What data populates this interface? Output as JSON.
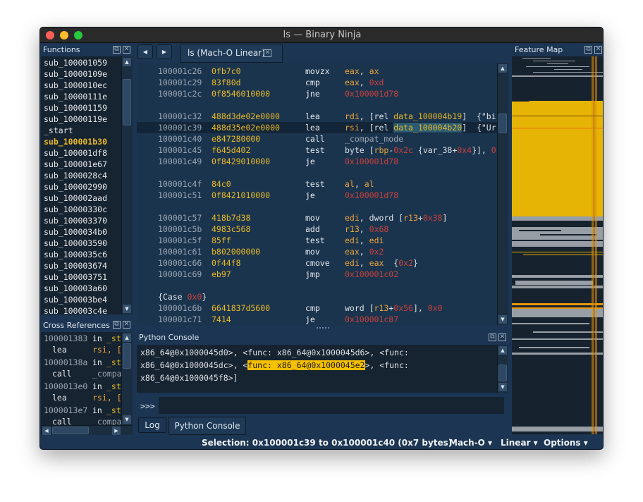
{
  "window": {
    "title": "ls — Binary Ninja"
  },
  "functions": {
    "title": "Functions",
    "items": [
      "sub_100001059",
      "sub_10000109e",
      "sub_1000010ec",
      "sub_10000111e",
      "sub_100001159",
      "sub_10000119e",
      "_start",
      "sub_100001b30",
      "sub_100001df8",
      "sub_100001e67",
      "sub_1000028c4",
      "sub_100002990",
      "sub_100002aad",
      "sub_10000330c",
      "sub_100003370",
      "sub_1000034b0",
      "sub_100003590",
      "sub_1000035c6",
      "sub_100003674",
      "sub_100003751",
      "sub_100003a60",
      "sub_100003be4",
      "sub_100003c4e"
    ],
    "selected": "sub_100001b30"
  },
  "xrefs": {
    "title": "Cross References",
    "items": [
      {
        "addr": "100001383",
        "in": "in",
        "func": "_st",
        "mn": "lea",
        "op": "rsi, [",
        "opclass": "reg"
      },
      {
        "addr": "10000138a",
        "in": "in",
        "func": "_st",
        "mn": "call",
        "op": "_compa",
        "opclass": "gray"
      },
      {
        "addr": "1000013e0",
        "in": "in",
        "func": "_st",
        "mn": "lea",
        "op": "rsi, [",
        "opclass": "reg"
      },
      {
        "addr": "1000013e7",
        "in": "in",
        "func": "_st",
        "mn": "call",
        "op": "_compa",
        "opclass": "gray"
      }
    ]
  },
  "tab": {
    "label": "ls (Mach-O Linear)"
  },
  "nav": {
    "back": "◀",
    "forward": "▶"
  },
  "code": [
    {
      "addr": "100001c26",
      "bytes": "0fb7c0",
      "mn": "movzx",
      "ops": [
        [
          "eax",
          "reg"
        ],
        [
          ", ",
          "plain"
        ],
        [
          "ax",
          "reg"
        ]
      ]
    },
    {
      "addr": "100001c29",
      "bytes": "83f80d",
      "mn": "cmp",
      "ops": [
        [
          "eax",
          "reg"
        ],
        [
          ", ",
          "plain"
        ],
        [
          "0xd",
          "num"
        ]
      ]
    },
    {
      "addr": "100001c2c",
      "bytes": "0f8546010000",
      "mn": "jne",
      "ops": [
        [
          "0x100001d78",
          "num"
        ]
      ]
    },
    {
      "blank": true
    },
    {
      "addr": "100001c32",
      "bytes": "488d3de02e0000",
      "mn": "lea",
      "ops": [
        [
          "rdi",
          "reg"
        ],
        [
          ", [rel ",
          "plain"
        ],
        [
          "data_100004b19",
          "sym"
        ],
        [
          "]  {\"bi",
          "plain"
        ]
      ]
    },
    {
      "addr": "100001c39",
      "bytes": "488d35e02e0000",
      "mn": "lea",
      "ops": [
        [
          "rsi",
          "reg"
        ],
        [
          ", [rel ",
          "plain"
        ],
        [
          "data_100004b20",
          "hl"
        ],
        [
          "]  {\"Ur",
          "plain"
        ]
      ],
      "selected": true
    },
    {
      "addr": "100001c40",
      "bytes": "e847280000",
      "mn": "call",
      "ops": [
        [
          "_compat_mode",
          "gray"
        ]
      ]
    },
    {
      "addr": "100001c45",
      "bytes": "f645d402",
      "mn": "test",
      "ops": [
        [
          "byte [",
          "plain"
        ],
        [
          "rbp",
          "reg"
        ],
        [
          "-",
          "plain"
        ],
        [
          "0x2c",
          "num"
        ],
        [
          " {var_38+",
          "plain"
        ],
        [
          "0x4",
          "num"
        ],
        [
          "}], ",
          "plain"
        ],
        [
          "0",
          "num"
        ]
      ]
    },
    {
      "addr": "100001c49",
      "bytes": "0f8429010000",
      "mn": "je",
      "ops": [
        [
          "0x100001d78",
          "num"
        ]
      ]
    },
    {
      "blank": true
    },
    {
      "addr": "100001c4f",
      "bytes": "84c0",
      "mn": "test",
      "ops": [
        [
          "al",
          "reg"
        ],
        [
          ", ",
          "plain"
        ],
        [
          "al",
          "reg"
        ]
      ]
    },
    {
      "addr": "100001c51",
      "bytes": "0f8421010000",
      "mn": "je",
      "ops": [
        [
          "0x100001d78",
          "num"
        ]
      ]
    },
    {
      "blank": true
    },
    {
      "addr": "100001c57",
      "bytes": "418b7d38",
      "mn": "mov",
      "ops": [
        [
          "edi",
          "reg"
        ],
        [
          ", dword [",
          "plain"
        ],
        [
          "r13",
          "reg"
        ],
        [
          "+",
          "plain"
        ],
        [
          "0x38",
          "num"
        ],
        [
          "]",
          "plain"
        ]
      ]
    },
    {
      "addr": "100001c5b",
      "bytes": "4983c568",
      "mn": "add",
      "ops": [
        [
          "r13",
          "reg"
        ],
        [
          ", ",
          "plain"
        ],
        [
          "0x68",
          "num"
        ]
      ]
    },
    {
      "addr": "100001c5f",
      "bytes": "85ff",
      "mn": "test",
      "ops": [
        [
          "edi",
          "reg"
        ],
        [
          ", ",
          "plain"
        ],
        [
          "edi",
          "reg"
        ]
      ]
    },
    {
      "addr": "100001c61",
      "bytes": "b802000000",
      "mn": "mov",
      "ops": [
        [
          "eax",
          "reg"
        ],
        [
          ", ",
          "plain"
        ],
        [
          "0x2",
          "num"
        ]
      ]
    },
    {
      "addr": "100001c66",
      "bytes": "0f44f8",
      "mn": "cmove",
      "ops": [
        [
          "edi",
          "reg"
        ],
        [
          ", ",
          "plain"
        ],
        [
          "eax",
          "reg"
        ],
        [
          "  {",
          "plain"
        ],
        [
          "0x2",
          "num"
        ],
        [
          "}",
          "plain"
        ]
      ]
    },
    {
      "addr": "100001c69",
      "bytes": "eb97",
      "mn": "jmp",
      "ops": [
        [
          "0x100001c02",
          "num"
        ]
      ]
    },
    {
      "blank": true
    },
    {
      "label": [
        [
          "{Case ",
          "plain"
        ],
        [
          "0x0",
          "num"
        ],
        [
          "}",
          "plain"
        ]
      ]
    },
    {
      "addr": "100001c6b",
      "bytes": "6641837d5600",
      "mn": "cmp",
      "ops": [
        [
          "word [",
          "plain"
        ],
        [
          "r13",
          "reg"
        ],
        [
          "+",
          "plain"
        ],
        [
          "0x56",
          "num"
        ],
        [
          "], ",
          "plain"
        ],
        [
          "0x0",
          "num"
        ]
      ]
    },
    {
      "addr": "100001c71",
      "bytes": "7414",
      "mn": "je",
      "ops": [
        [
          "0x100001c87",
          "num"
        ]
      ]
    }
  ],
  "console": {
    "title": "Python Console",
    "lines": [
      [
        [
          "x86_64@0x1000045d0>, <func: x86_64@0x1000045d6>, <func:",
          "plain"
        ]
      ],
      [
        [
          "x86_64@0x1000045dc>, <",
          "plain"
        ],
        [
          "func: x86_64@0x1000045e2",
          "hl"
        ],
        [
          ">, <func:",
          "plain"
        ]
      ],
      [
        [
          "x86_64@0x1000045f8>]",
          "plain"
        ]
      ]
    ],
    "prompt": ">>>",
    "input": ""
  },
  "bottom_tabs": [
    "Log",
    "Python Console"
  ],
  "active_bottom_tab": "Python Console",
  "feature_map": {
    "title": "Feature Map"
  },
  "status": {
    "selection": "Selection: 0x100001c39 to 0x100001c40 (0x7 bytes)",
    "menus": [
      "Mach-O ▾",
      "Linear ▾",
      "Options ▾"
    ]
  },
  "colors": {
    "accent": "#e8b923",
    "background": "#1b3552",
    "number": "#c8403a",
    "register": "#eba53a"
  }
}
